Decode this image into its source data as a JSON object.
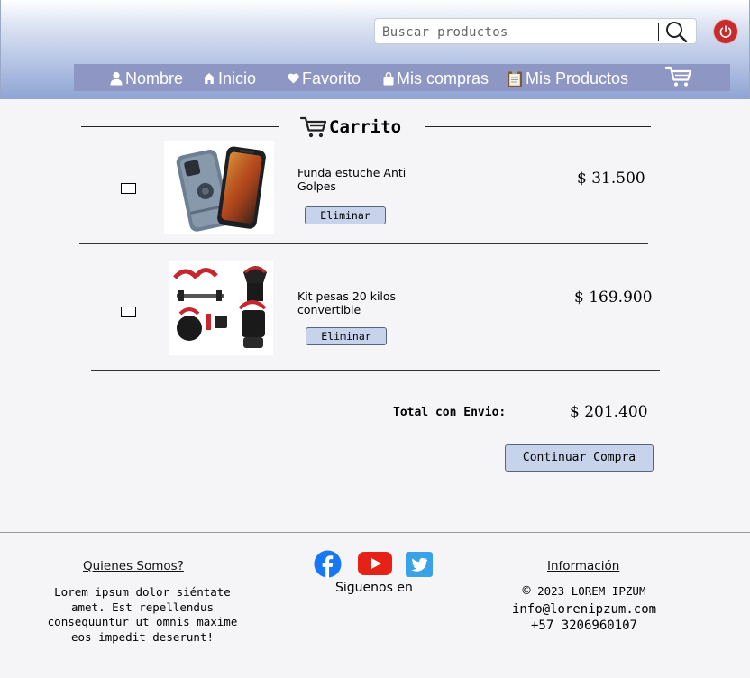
{
  "header": {
    "search": {
      "placeholder": "Buscar productos",
      "value": ""
    },
    "nav": [
      {
        "label": "Nombre",
        "icon": "user-icon"
      },
      {
        "label": "Inicio",
        "icon": "home-icon"
      },
      {
        "label": "Favorito",
        "icon": "heart-icon"
      },
      {
        "label": "Mis compras",
        "icon": "shopping-bag-icon"
      },
      {
        "label": "Mis Productos",
        "icon": "clipboard-icon"
      }
    ],
    "cart_icon": "cart-icon",
    "logout_icon": "power-icon",
    "colors": {
      "power": "#c62c2c",
      "navbar": "#8e97c4"
    }
  },
  "cart": {
    "title": "Carrito",
    "items": [
      {
        "name": "Funda estuche Anti Golpes",
        "price": "$ 31.500",
        "remove_label": "Eliminar",
        "checked": false
      },
      {
        "name": "Kit pesas 20 kilos convertible",
        "price": "$ 169.900",
        "remove_label": "Eliminar",
        "checked": false
      }
    ],
    "total_label": "Total con Envio:",
    "total_value": "$ 201.400",
    "continue_label": "Continuar Compra"
  },
  "footer": {
    "about": {
      "title": "Quienes Somos?",
      "text": "Lorem ipsum dolor siéntate amet. Est repellendus consequuntur ut omnis maxime eos impedit deserunt!"
    },
    "social": {
      "label": "Siguenos en",
      "networks": [
        "facebook-icon",
        "youtube-icon",
        "twitter-icon"
      ]
    },
    "info": {
      "title": "Información",
      "copyright": "2023 LOREM IPZUM",
      "email": "info@lorenipzum.com",
      "phone": "+57 3206960107"
    }
  }
}
